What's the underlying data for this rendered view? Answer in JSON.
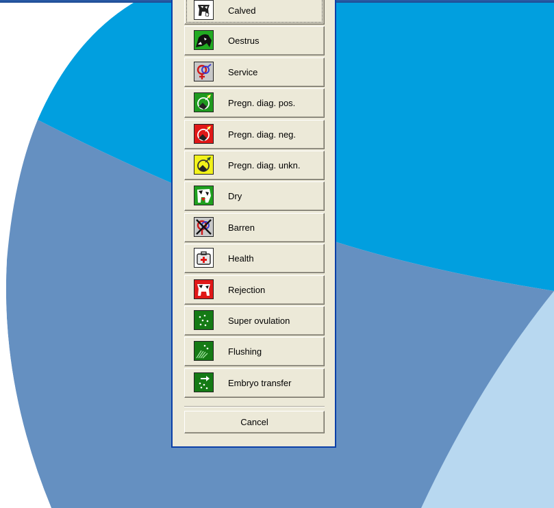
{
  "background": {
    "colors": {
      "top": "#019fdf",
      "middle": "#6590c1",
      "light": "#b8d8f0",
      "frame": "#2d5ea8"
    }
  },
  "dialog": {
    "events": [
      {
        "label": "Calved",
        "icon": "calved-icon",
        "color": "#ffffff"
      },
      {
        "label": "Oestrus",
        "icon": "oestrus-icon",
        "color": "#22aa22"
      },
      {
        "label": "Service",
        "icon": "service-icon",
        "color": "#c8c8c8"
      },
      {
        "label": "Pregn. diag. pos.",
        "icon": "pregnancy-positive-icon",
        "color": "#1f9a1f"
      },
      {
        "label": "Pregn. diag. neg.",
        "icon": "pregnancy-negative-icon",
        "color": "#e01818"
      },
      {
        "label": "Pregn. diag. unkn.",
        "icon": "pregnancy-unknown-icon",
        "color": "#f2f21a"
      },
      {
        "label": "Dry",
        "icon": "dry-icon",
        "color": "#1fa01f"
      },
      {
        "label": "Barren",
        "icon": "barren-icon",
        "color": "#c8c8c8"
      },
      {
        "label": "Health",
        "icon": "health-icon",
        "color": "#ffffff"
      },
      {
        "label": "Rejection",
        "icon": "rejection-icon",
        "color": "#e01818"
      },
      {
        "label": "Super ovulation",
        "icon": "super-ovulation-icon",
        "color": "#157a15"
      },
      {
        "label": "Flushing",
        "icon": "flushing-icon",
        "color": "#157a15"
      },
      {
        "label": "Embryo transfer",
        "icon": "embryo-transfer-icon",
        "color": "#157a15"
      }
    ],
    "cancel_label": "Cancel"
  }
}
